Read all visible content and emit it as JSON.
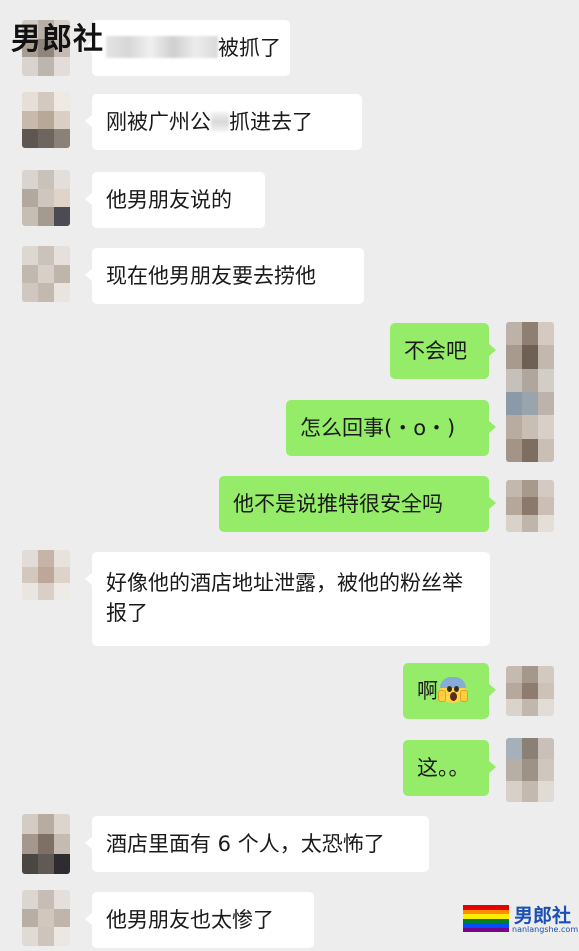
{
  "watermark": {
    "top_label": "男郎社",
    "logo_label": "男郎社",
    "logo_url": "nanlangshe.com",
    "flag_colors": [
      "#e40303",
      "#ff8c00",
      "#ffed00",
      "#008026",
      "#004dff",
      "#750787"
    ]
  },
  "colors": {
    "background": "#ededed",
    "incoming_bubble": "#ffffff",
    "outgoing_bubble": "#95ec69"
  },
  "messages": [
    {
      "side": "in",
      "text": "被抓了",
      "redacted_prefix": true
    },
    {
      "side": "in",
      "text_before": "刚被广州公",
      "text_after": "抓进去了",
      "redacted_middle": true
    },
    {
      "side": "in",
      "text": "他男朋友说的"
    },
    {
      "side": "in",
      "text": "现在他男朋友要去捞他"
    },
    {
      "side": "out",
      "text": "不会吧"
    },
    {
      "side": "out",
      "text": "怎么回事(・o・)"
    },
    {
      "side": "out",
      "text": "他不是说推特很安全吗"
    },
    {
      "side": "in",
      "text": "好像他的酒店地址泄露，被他的粉丝举报了"
    },
    {
      "side": "out",
      "text": "啊",
      "emoji": "scream-face-icon"
    },
    {
      "side": "out",
      "text": "这。。"
    },
    {
      "side": "in",
      "text": "酒店里面有 6 个人，太恐怖了"
    },
    {
      "side": "in",
      "text": "他男朋友也太惨了"
    }
  ]
}
